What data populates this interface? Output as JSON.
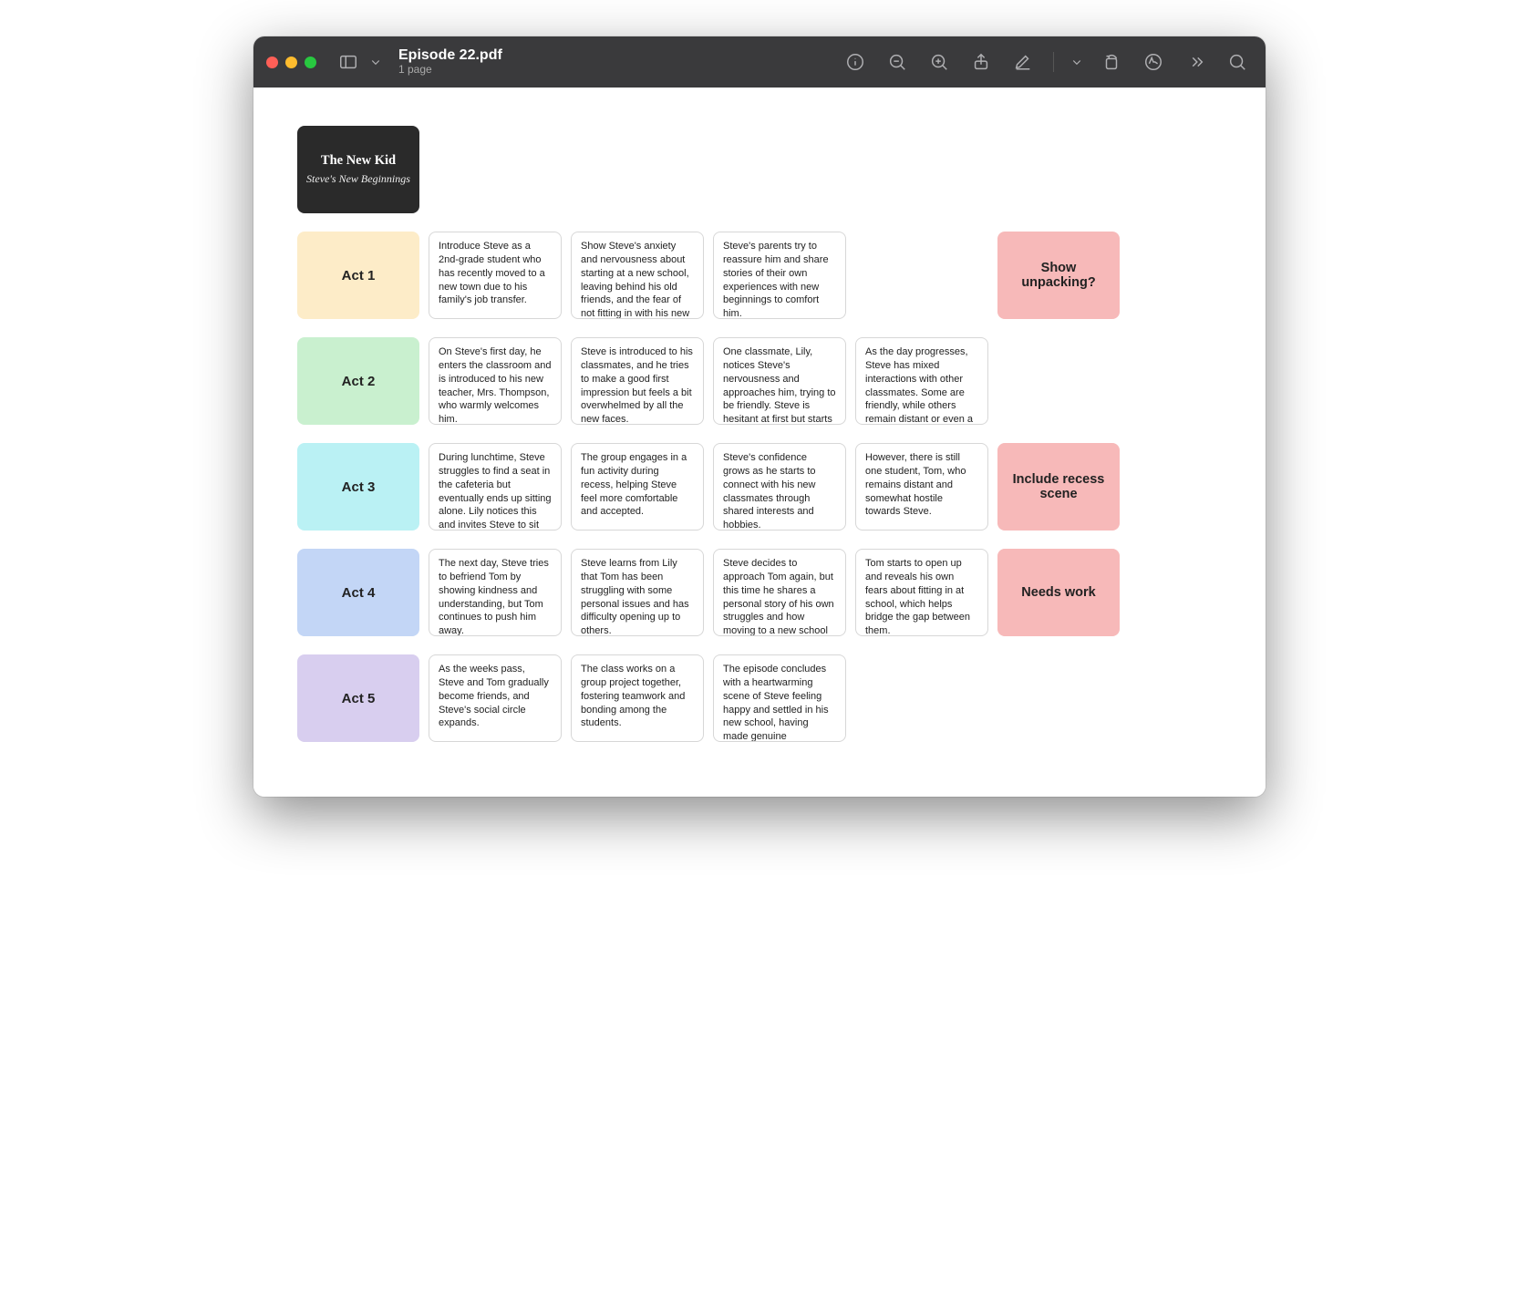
{
  "window": {
    "filename": "Episode 22.pdf",
    "subtitle": "1 page"
  },
  "document": {
    "title_card": {
      "main": "The New Kid",
      "sub": "Steve's New Beginnings"
    },
    "acts": [
      {
        "label": "Act 1",
        "color": "#fdecc8",
        "cards": [
          "Introduce Steve as a 2nd-grade student who has recently moved to a new town due to his family's job transfer.",
          "Show Steve's anxiety and nervousness about starting at a new school, leaving behind his old friends, and the fear of not fitting in with his new",
          "Steve's parents try to reassure him and share stories of their own experiences with new beginnings to comfort him.",
          ""
        ],
        "flag": "Show unpacking?"
      },
      {
        "label": "Act 2",
        "color": "#c9f0cf",
        "cards": [
          "On Steve's first day, he enters the classroom and is introduced to his new teacher, Mrs. Thompson, who warmly welcomes him.",
          "Steve is introduced to his classmates, and he tries to make a good first impression but feels a bit overwhelmed by all the new faces.",
          "One classmate, Lily, notices Steve's nervousness and approaches him, trying to be friendly. Steve is hesitant at first but starts",
          "As the day progresses, Steve has mixed interactions with other classmates. Some are friendly, while others remain distant or even a"
        ],
        "flag": ""
      },
      {
        "label": "Act 3",
        "color": "#baf1f4",
        "cards": [
          "During lunchtime, Steve struggles to find a seat in the cafeteria but eventually ends up sitting alone. Lily notices this and invites Steve to sit with",
          "The group engages in a fun activity during recess, helping Steve feel more comfortable and accepted.",
          "Steve's confidence grows as he starts to connect with his new classmates through shared interests and hobbies.",
          "However, there is still one student, Tom, who remains distant and somewhat hostile towards Steve."
        ],
        "flag": "Include recess scene"
      },
      {
        "label": "Act 4",
        "color": "#c3d6f6",
        "cards": [
          "The next day, Steve tries to befriend Tom by showing kindness and understanding, but Tom continues to push him away.",
          "Steve learns from Lily that Tom has been struggling with some personal issues and has difficulty opening up to others.",
          "Steve decides to approach Tom again, but this time he shares a personal story of his own struggles and how moving to a new school made him",
          "Tom starts to open up and reveals his own fears about fitting in at school, which helps bridge the gap between them."
        ],
        "flag": "Needs work"
      },
      {
        "label": "Act 5",
        "color": "#d8ceef",
        "cards": [
          "As the weeks pass, Steve and Tom gradually become friends, and Steve's social circle expands.",
          "The class works on a group project together, fostering teamwork and bonding among the students.",
          "The episode concludes with a heartwarming scene of Steve feeling happy and settled in his new school, having made genuine connections with",
          ""
        ],
        "flag": ""
      }
    ]
  }
}
